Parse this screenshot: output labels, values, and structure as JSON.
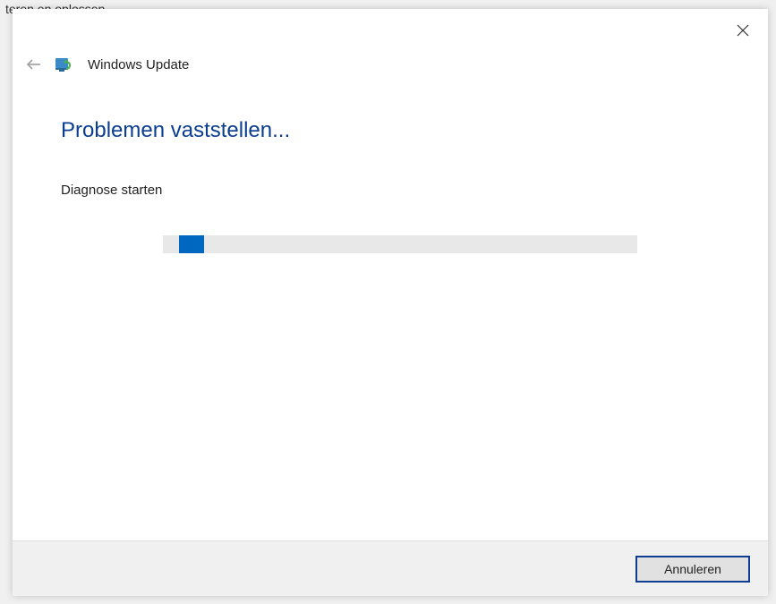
{
  "background": {
    "partial_text": "teren en oplossen"
  },
  "dialog": {
    "app_title": "Windows Update",
    "heading": "Problemen vaststellen...",
    "status": "Diagnose starten",
    "footer": {
      "cancel_label": "Annuleren"
    },
    "progress": {
      "indeterminate": true,
      "position_pct": 4
    }
  }
}
